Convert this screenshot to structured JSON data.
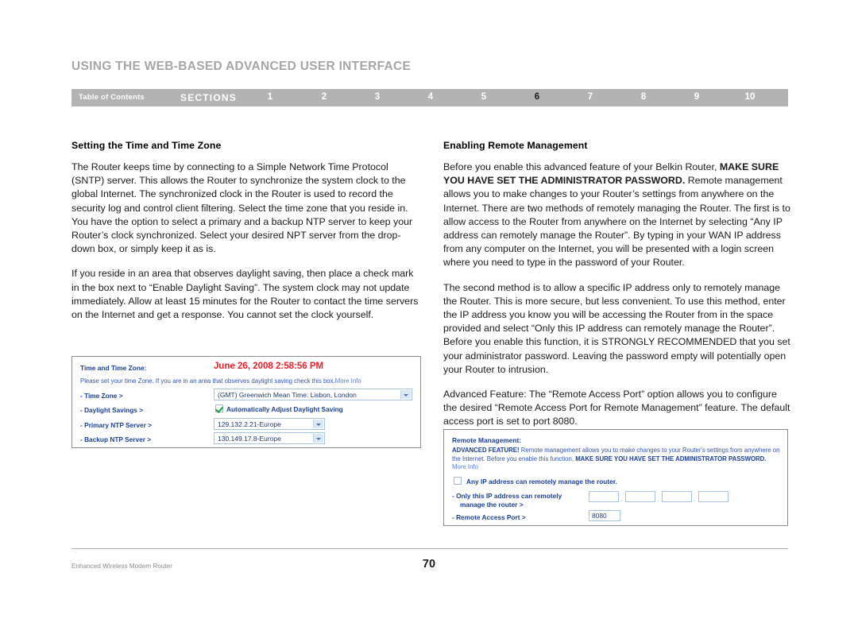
{
  "header": {
    "title": "USING THE WEB-BASED ADVANCED USER INTERFACE",
    "nav": {
      "toc_label": "Table of Contents",
      "sections_label": "SECTIONS",
      "numbers": [
        "1",
        "2",
        "3",
        "4",
        "5",
        "6",
        "7",
        "8",
        "9",
        "10"
      ],
      "active_number": "6",
      "bar_color": "#b3b3b3",
      "active_color": "#1a1a1a",
      "inactive_color": "#ffffff"
    }
  },
  "left_column": {
    "heading": "Setting the Time and Time Zone",
    "paragraphs": [
      "The Router keeps time by connecting to a Simple Network Time Protocol (SNTP) server. This allows the Router to synchronize the system clock to the global Internet. The synchronized clock in the Router is used to record the security log and control client filtering. Select the time zone that you reside in. You have the option to select a primary and a backup NTP server to keep your Router’s clock synchronized. Select your desired NPT server from the drop-down box, or simply keep it as is.",
      "If you reside in an area that observes daylight saving, then place a check mark in the box next to “Enable Daylight Saving”. The system clock may not update immediately. Allow at least 15 minutes for the Router to contact the time servers on the Internet and get a response. You cannot set the clock yourself."
    ]
  },
  "right_column": {
    "heading": "Enabling Remote Management",
    "paragraph1_pre": "Before you enable this advanced feature of your Belkin Router, ",
    "paragraph1_bold": "MAKE SURE YOU HAVE SET THE ADMINISTRATOR PASSWORD.",
    "paragraph1_post": " Remote management allows you to make changes to your Router’s settings from anywhere on the Internet. There are two methods of remotely managing the Router. The first is to allow access to the Router from anywhere on the Internet by selecting “Any IP address can remotely manage the Router”. By typing in your WAN IP address from any computer on the Internet, you will be presented with a login screen where you need to type in the password of your Router.",
    "paragraph2": "The second method is to allow a specific IP address only to remotely manage the Router. This is more secure, but less convenient. To use this method, enter the IP address you know you will be accessing the Router from in the space provided and select “Only this IP address can remotely manage the Router”. Before you enable this function, it is STRONGLY RECOMMENDED that you set your administrator password. Leaving the password empty will potentially open your Router to intrusion.",
    "paragraph3": "Advanced Feature: The “Remote Access Port” option allows you to configure the desired “Remote Access Port for Remote Management” feature. The default access port is set to port 8080."
  },
  "time_panel": {
    "title": "Time and Time Zone:",
    "clock": "June 26, 2008   2:58:56 PM",
    "clock_color": "#e8202a",
    "note": "Please set your time Zone. If you are in an area that observes daylight saving check this box.",
    "note_link": "More Info",
    "rows": {
      "time_zone_label": "- Time Zone >",
      "time_zone_value": "(GMT) Greenwich Mean Time: Lisbon, London",
      "daylight_label": "- Daylight Savings >",
      "daylight_checkbox_label": "Automatically Adjust Daylight Saving",
      "daylight_checked": true,
      "primary_ntp_label": "- Primary NTP Server >",
      "primary_ntp_value": "129.132.2.21-Europe",
      "backup_ntp_label": "- Backup NTP Server >",
      "backup_ntp_value": "130.149.17.8-Europe"
    }
  },
  "remote_panel": {
    "title": "Remote Management:",
    "note_bold1": "ADVANCED FEATURE!",
    "note_text1": " Remote management allows you to make changes to your Router's settings from anywhere on the Internet. Before you enable this function, ",
    "note_bold2": "MAKE SURE YOU HAVE SET THE ADMINISTRATOR PASSWORD.",
    "note_link": "More Info",
    "any_ip_label": "Any IP address can remotely manage the router.",
    "any_ip_checked": false,
    "only_ip_label_line1": "- Only this IP address can remotely",
    "only_ip_label_line2": "manage the router >",
    "ip_octets": [
      "",
      "",
      "",
      ""
    ],
    "ip_separator": ".",
    "access_port_label": "- Remote Access Port >",
    "access_port_value": "8080"
  },
  "footer": {
    "product": "Enhanced Wireless Modem Router",
    "page_number": "70"
  }
}
